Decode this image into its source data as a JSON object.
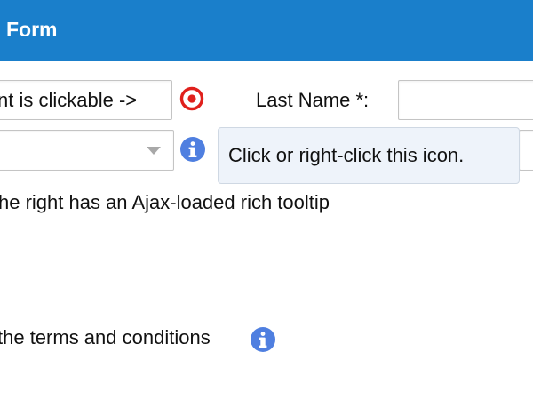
{
  "header": {
    "title": "Form"
  },
  "row1": {
    "clickable_field_value": "nt is clickable ->",
    "last_name_label": "Last Name *:",
    "last_name_value": ""
  },
  "row2": {
    "select_value": "",
    "tooltip_text": "Click or right-click this icon."
  },
  "hint": {
    "text": "he right has an Ajax-loaded rich tooltip"
  },
  "terms": {
    "text": "the terms and conditions"
  },
  "icons": {
    "target": "target-icon",
    "info": "info-icon",
    "dropdown": "chevron-down-icon"
  },
  "colors": {
    "header_bg": "#1a7fcb",
    "header_text": "#ffffff",
    "target_red": "#e0201c",
    "info_blue": "#4f7fe0",
    "tooltip_bg": "#eef3fa"
  }
}
